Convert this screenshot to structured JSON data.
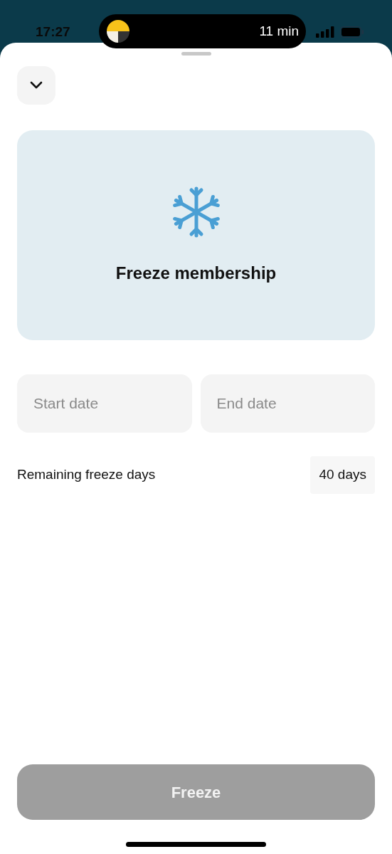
{
  "status_bar": {
    "time": "17:27"
  },
  "live_activity": {
    "text": "11 min"
  },
  "card": {
    "title": "Freeze membership"
  },
  "date_fields": [
    {
      "placeholder": "Start date"
    },
    {
      "placeholder": "End date"
    }
  ],
  "remaining": {
    "label": "Remaining freeze days",
    "value": "40 days"
  },
  "freeze_button": {
    "label": "Freeze",
    "disabled": true
  }
}
